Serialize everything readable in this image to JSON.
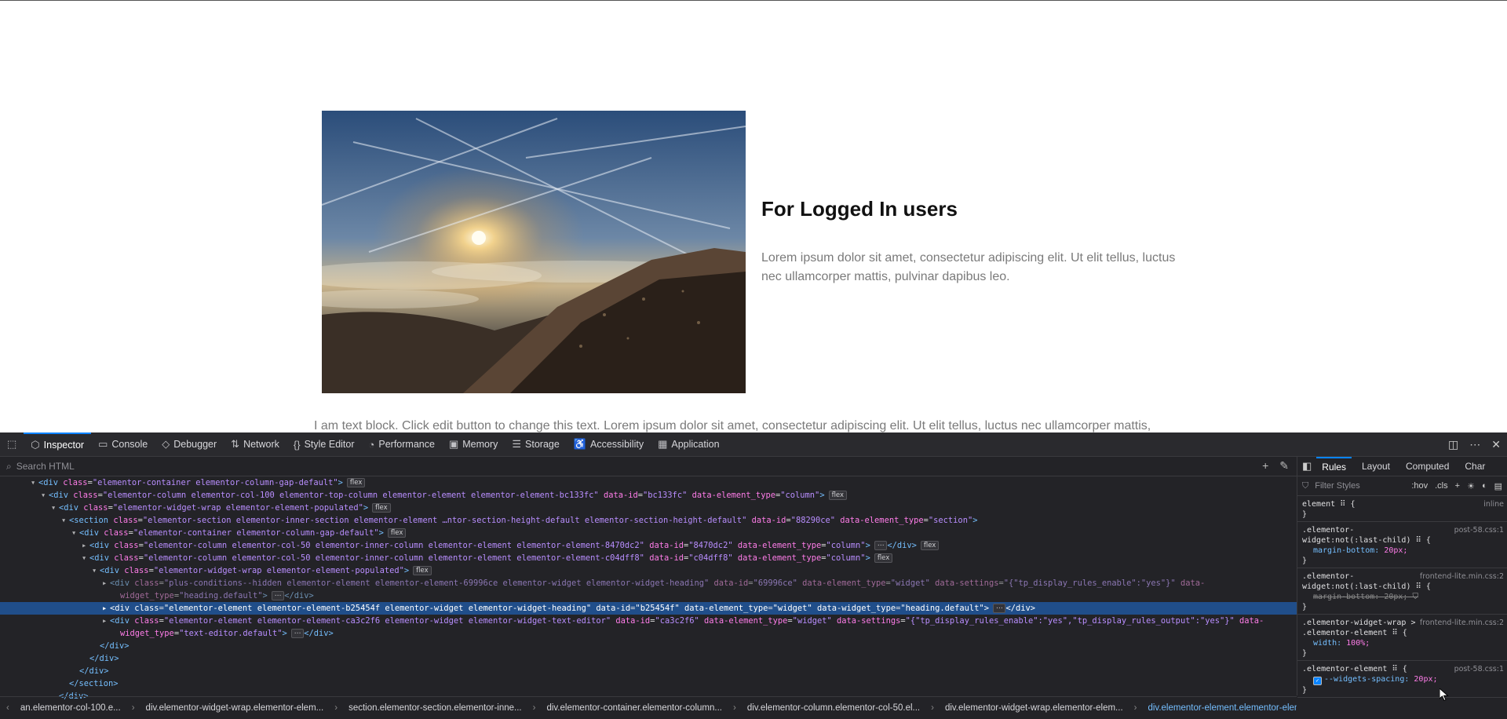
{
  "page": {
    "heading": "For Logged In users",
    "paragraph": "Lorem ipsum dolor sit amet, consectetur adipiscing elit. Ut elit tellus, luctus nec ullamcorper mattis, pulvinar dapibus leo.",
    "text_block": "I am text block. Click edit button to change this text. Lorem ipsum dolor sit amet, consectetur adipiscing elit. Ut elit tellus, luctus nec ullamcorper mattis,"
  },
  "devtools": {
    "tabs": [
      {
        "label": "Inspector",
        "icon": "inspector-icon"
      },
      {
        "label": "Console",
        "icon": "console-icon"
      },
      {
        "label": "Debugger",
        "icon": "debugger-icon"
      },
      {
        "label": "Network",
        "icon": "network-icon"
      },
      {
        "label": "Style Editor",
        "icon": "style-editor-icon"
      },
      {
        "label": "Performance",
        "icon": "performance-icon"
      },
      {
        "label": "Memory",
        "icon": "memory-icon"
      },
      {
        "label": "Storage",
        "icon": "storage-icon"
      },
      {
        "label": "Accessibility",
        "icon": "accessibility-icon"
      },
      {
        "label": "Application",
        "icon": "application-icon"
      }
    ],
    "search_placeholder": "Search HTML",
    "breadcrumbs": [
      "an.elementor-col-100.e...",
      "div.elementor-widget-wrap.elementor-elem...",
      "section.elementor-section.elementor-inne...",
      "div.elementor-container.elementor-column...",
      "div.elementor-column.elementor-col-50.el...",
      "div.elementor-widget-wrap.elementor-elem...",
      "div.elementor-element.elementor-element-..."
    ],
    "rules_tabs": [
      "Rules",
      "Layout",
      "Computed",
      "Char"
    ],
    "filter_placeholder": "Filter Styles",
    "hov": ":hov",
    "cls": ".cls",
    "rules": [
      {
        "selector": "element ⠿ {",
        "source": "inline",
        "props": [],
        "close": "}"
      },
      {
        "selector": ".elementor-widget:not(:last-child) ⠿ {",
        "source": "post-58.css:1",
        "props": [
          {
            "name": "margin-bottom",
            "value": "20px;",
            "struck": false
          }
        ],
        "close": "}"
      },
      {
        "selector": ".elementor-widget:not(:last-child) ⠿ {",
        "source": "frontend-lite.min.css:2",
        "props": [
          {
            "name": "margin-bottom",
            "value": "20px;",
            "struck": true
          }
        ],
        "close": "}"
      },
      {
        "selector": ".elementor-widget-wrap > .elementor-element ⠿ {",
        "source": "frontend-lite.min.css:2",
        "props": [
          {
            "name": "width",
            "value": "100%;",
            "struck": false
          }
        ],
        "close": "}"
      },
      {
        "selector": ".elementor-element ⠿ {",
        "source": "post-58.css:1",
        "props": [
          {
            "name": "--widgets-spacing",
            "value": "20px;",
            "struck": false
          }
        ],
        "close": "}"
      }
    ],
    "badge_flex": "flex",
    "badge_ellipsis": "⋯",
    "tree": [
      {
        "i": 3,
        "tw": "▾",
        "open": "<div ",
        "attrs": [
          [
            "class",
            "elementor-container elementor-column-gap-default"
          ]
        ],
        "end": ">",
        "badge": true
      },
      {
        "i": 4,
        "tw": "▾",
        "open": "<div ",
        "attrs": [
          [
            "class",
            "elementor-column elementor-col-100 elementor-top-column elementor-element elementor-element-bc133fc"
          ],
          [
            "data-id",
            "bc133fc"
          ],
          [
            "data-element_type",
            "column"
          ]
        ],
        "end": ">",
        "badge": true
      },
      {
        "i": 5,
        "tw": "▾",
        "open": "<div ",
        "attrs": [
          [
            "class",
            "elementor-widget-wrap elementor-element-populated"
          ]
        ],
        "end": ">",
        "badge": true
      },
      {
        "i": 6,
        "tw": "▾",
        "open": "<section ",
        "attrs": [
          [
            "class",
            "elementor-section elementor-inner-section elementor-element …ntor-section-height-default elementor-section-height-default"
          ],
          [
            "data-id",
            "88290ce"
          ],
          [
            "data-element_type",
            "section"
          ]
        ],
        "end": ">",
        "badge": false
      },
      {
        "i": 7,
        "tw": "▾",
        "open": "<div ",
        "attrs": [
          [
            "class",
            "elementor-container elementor-column-gap-default"
          ]
        ],
        "end": ">",
        "badge": true
      },
      {
        "i": 8,
        "tw": "▸",
        "open": "<div ",
        "attrs": [
          [
            "class",
            "elementor-column elementor-col-50 elementor-inner-column elementor-element elementor-element-8470dc2"
          ],
          [
            "data-id",
            "8470dc2"
          ],
          [
            "data-element_type",
            "column"
          ]
        ],
        "end": ">",
        "ellipsis": true,
        "closetag": "</div>",
        "badge": true
      },
      {
        "i": 8,
        "tw": "▾",
        "open": "<div ",
        "attrs": [
          [
            "class",
            "elementor-column elementor-col-50 elementor-inner-column elementor-element elementor-element-c04dff8"
          ],
          [
            "data-id",
            "c04dff8"
          ],
          [
            "data-element_type",
            "column"
          ]
        ],
        "end": ">",
        "badge": true
      },
      {
        "i": 9,
        "tw": "▾",
        "open": "<div ",
        "attrs": [
          [
            "class",
            "elementor-widget-wrap elementor-element-populated"
          ]
        ],
        "end": ">",
        "badge": true
      },
      {
        "i": 10,
        "tw": "▸",
        "dim": true,
        "open": "<div ",
        "attrs": [
          [
            "class",
            "plus-conditions--hidden elementor-element elementor-element-69996ce elementor-widget elementor-widget-heading"
          ],
          [
            "data-id",
            "69996ce"
          ],
          [
            "data-element_type",
            "widget"
          ],
          [
            "data-settings",
            "{\"tp_display_rules_enable\":\"yes\"}"
          ]
        ],
        "tailattr": "data-",
        "end": ""
      },
      {
        "i": 11,
        "tw": "",
        "dim": true,
        "open": "",
        "attrs": [
          [
            "widget_type",
            "heading.default"
          ]
        ],
        "end": ">",
        "ellipsis": true,
        "closetag": "</div>"
      },
      {
        "i": 10,
        "tw": "▸",
        "sel": true,
        "open": "<div ",
        "attrs": [
          [
            "class",
            "elementor-element elementor-element-b25454f elementor-widget elementor-widget-heading"
          ],
          [
            "data-id",
            "b25454f"
          ],
          [
            "data-element_type",
            "widget"
          ],
          [
            "data-widget_type",
            "heading.default"
          ]
        ],
        "end": ">",
        "ellipsis": true,
        "closetag": "</div>"
      },
      {
        "i": 10,
        "tw": "▸",
        "open": "<div ",
        "attrs": [
          [
            "class",
            "elementor-element elementor-element-ca3c2f6 elementor-widget elementor-widget-text-editor"
          ],
          [
            "data-id",
            "ca3c2f6"
          ],
          [
            "data-element_type",
            "widget"
          ],
          [
            "data-settings",
            "{\"tp_display_rules_enable\":\"yes\",\"tp_display_rules_output\":\"yes\"}"
          ]
        ],
        "tailattr": "data-",
        "end": ""
      },
      {
        "i": 11,
        "tw": "",
        "open": "",
        "attrs": [
          [
            "widget_type",
            "text-editor.default"
          ]
        ],
        "end": ">",
        "ellipsis": true,
        "closetag": "</div>"
      },
      {
        "i": 9,
        "tw": "",
        "open": "</div>",
        "attrs": [],
        "end": ""
      },
      {
        "i": 8,
        "tw": "",
        "open": "</div>",
        "attrs": [],
        "end": ""
      },
      {
        "i": 7,
        "tw": "",
        "open": "</div>",
        "attrs": [],
        "end": ""
      },
      {
        "i": 6,
        "tw": "",
        "open": "</section>",
        "attrs": [],
        "end": ""
      },
      {
        "i": 5,
        "tw": "",
        "open": "</div>",
        "attrs": [],
        "end": ""
      }
    ]
  },
  "colors": {
    "devtools_bg": "#232327",
    "accent": "#0a84ff",
    "selection": "#204e8a",
    "tag": "#75bfff",
    "attr": "#ff7de9",
    "value": "#b98eff"
  }
}
